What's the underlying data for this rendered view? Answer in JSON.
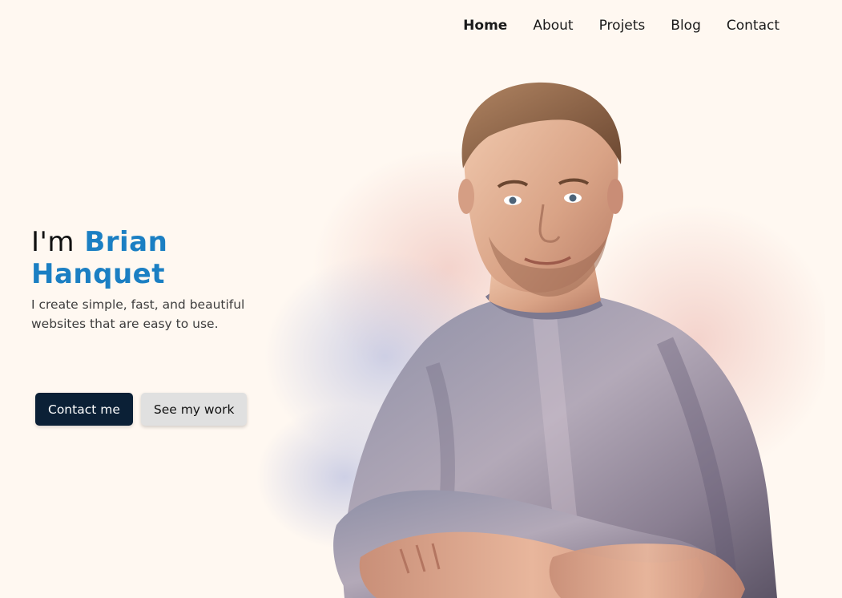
{
  "nav": {
    "items": [
      {
        "label": "Home",
        "active": true
      },
      {
        "label": "About",
        "active": false
      },
      {
        "label": "Projets",
        "active": false
      },
      {
        "label": "Blog",
        "active": false
      },
      {
        "label": "Contact",
        "active": false
      }
    ]
  },
  "hero": {
    "greeting": "I'm",
    "name_first": "Brian",
    "name_last": "Hanquet",
    "tagline": "I create simple, fast, and beautiful websites that are easy to use."
  },
  "buttons": {
    "primary_label": "Contact me",
    "secondary_label": "See my work"
  },
  "colors": {
    "background": "#fff8f1",
    "accent": "#1b7fc3",
    "primary_button": "#0b2036",
    "secondary_button": "#e0e0e0"
  },
  "portrait": {
    "subject": "watercolor portrait of a man with crossed arms in a grey t-shirt"
  }
}
